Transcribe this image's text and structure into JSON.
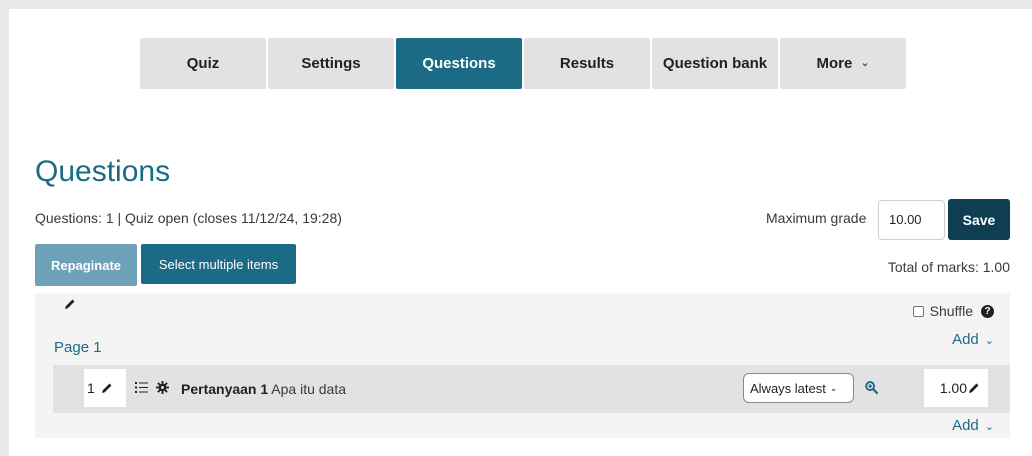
{
  "tabs": [
    {
      "label": "Quiz",
      "active": false
    },
    {
      "label": "Settings",
      "active": false
    },
    {
      "label": "Questions",
      "active": true
    },
    {
      "label": "Results",
      "active": false
    },
    {
      "label": "Question bank",
      "active": false
    },
    {
      "label": "More",
      "active": false
    }
  ],
  "page": {
    "title": "Questions",
    "info": "Questions: 1 | Quiz open (closes 11/12/24, 19:28)"
  },
  "grade": {
    "label": "Maximum grade",
    "value": "10.00",
    "save_label": "Save",
    "total_marks": "Total of marks: 1.00"
  },
  "actions": {
    "repaginate": "Repaginate",
    "select_multiple": "Select multiple items"
  },
  "section": {
    "shuffle_label": "Shuffle",
    "shuffle_checked": false,
    "add_label": "Add",
    "page_label": "Page 1"
  },
  "question": {
    "number": "1",
    "name": "Pertanyaan 1",
    "text": "Apa itu data",
    "version": "Always latest",
    "mark": "1.00"
  },
  "icons": {
    "edit": "pencil-icon",
    "drag": "list-drag-icon",
    "type": "gear-icon",
    "preview": "magnifier-plus-icon",
    "help": "question-circle-icon"
  },
  "colors": {
    "primary": "#1b6a86",
    "dark_button": "#0f3e52",
    "disabled_button": "#6ea2bb",
    "tab_bg": "#e2e2e2"
  }
}
